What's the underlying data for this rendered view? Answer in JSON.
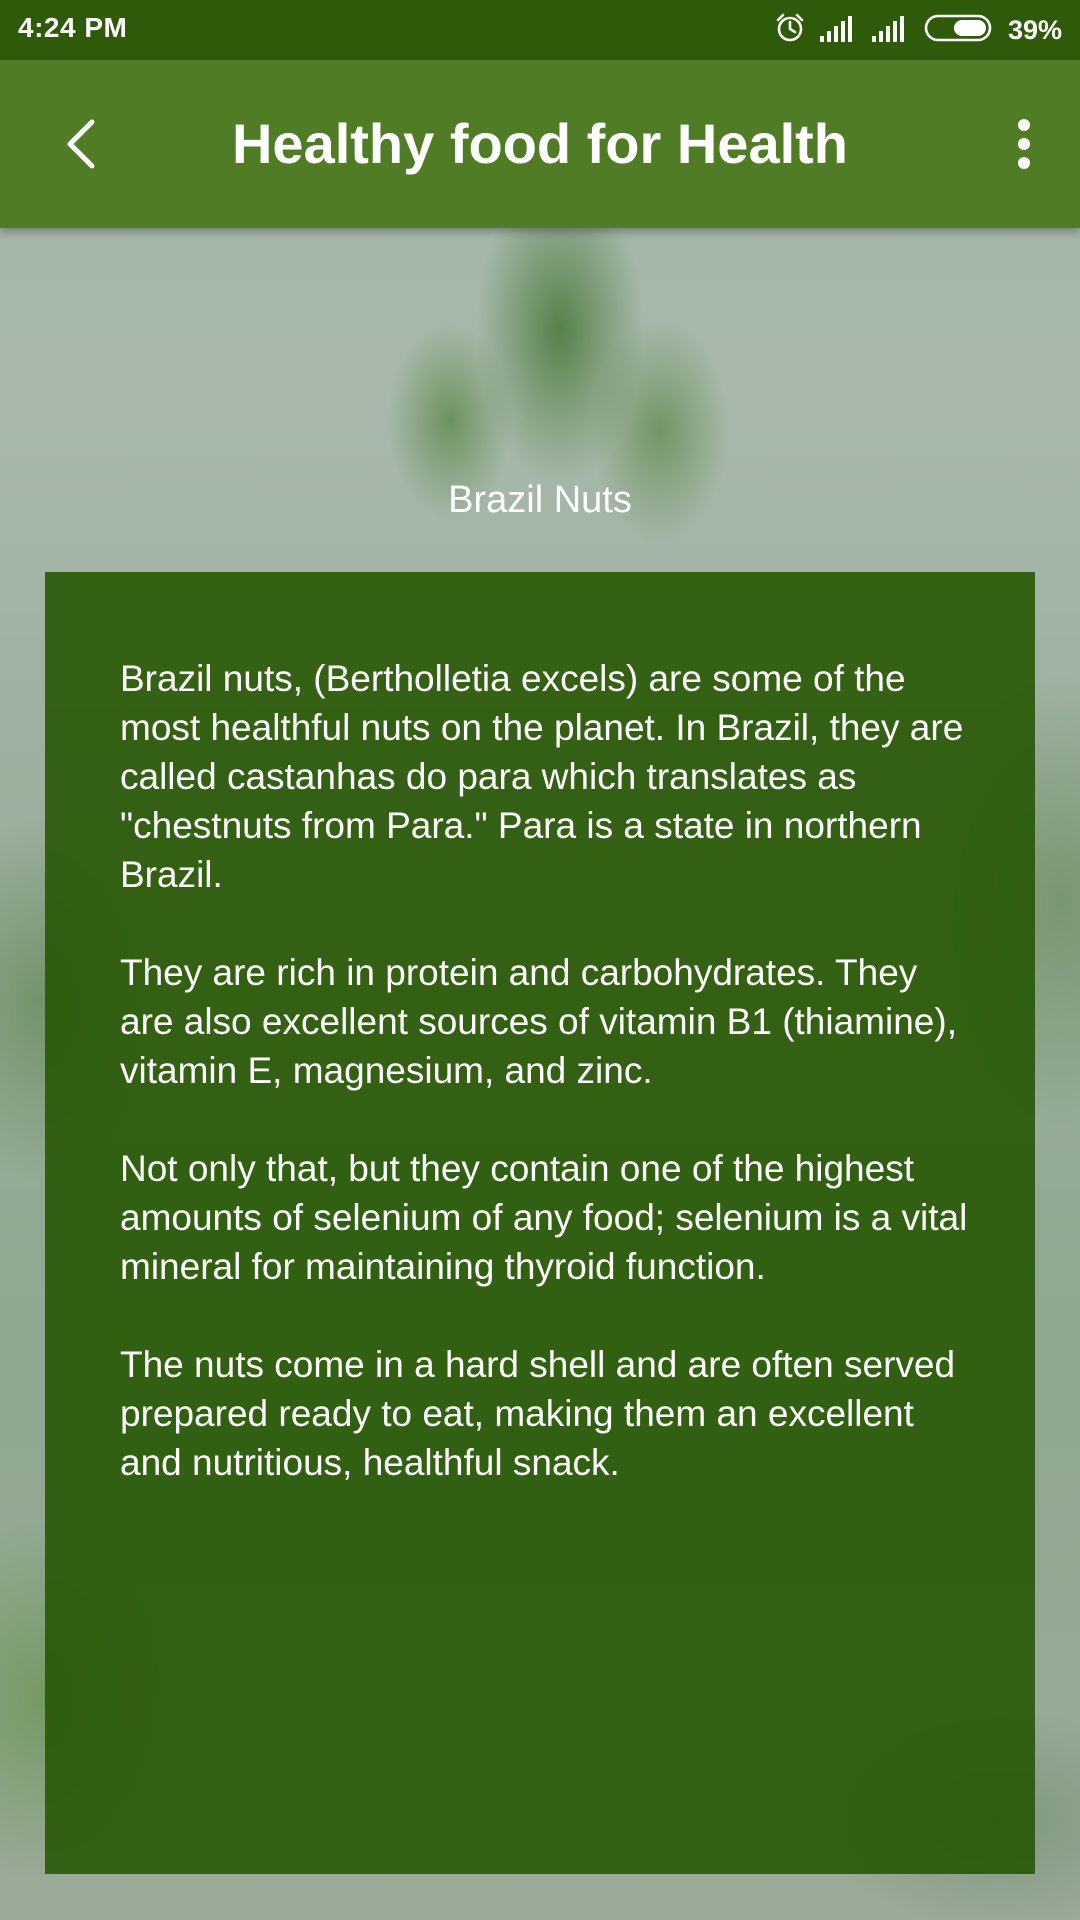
{
  "status_bar": {
    "time": "4:24 PM",
    "battery_percent": "39%",
    "icons": [
      "alarm-icon",
      "signal-icon",
      "signal-icon",
      "battery-icon"
    ]
  },
  "app_bar": {
    "title": "Healthy food for Health",
    "back_icon": "chevron-left-icon",
    "menu_icon": "more-vertical-icon"
  },
  "content": {
    "heading": "Brazil Nuts",
    "paragraphs": [
      "Brazil nuts, (Bertholletia excels) are some of the most healthful nuts on the planet. In Brazil, they are called castanhas do para which translates as \"chestnuts from Para.\" Para is a state in northern Brazil.",
      "They are rich in protein and carbohydrates. They are also excellent sources of vitamin B1 (thiamine), vitamin E, magnesium, and zinc.",
      "Not only that, but they contain one of the highest amounts of selenium of any food; selenium is a vital mineral for maintaining thyroid function.",
      "The nuts come in a hard shell and are often served prepared ready to eat, making them an excellent and nutritious, healthful snack."
    ]
  },
  "colors": {
    "status_bar": "#2f5a0a",
    "app_bar": "#4f7c24",
    "card": "#285804",
    "text": "#ffffff"
  }
}
